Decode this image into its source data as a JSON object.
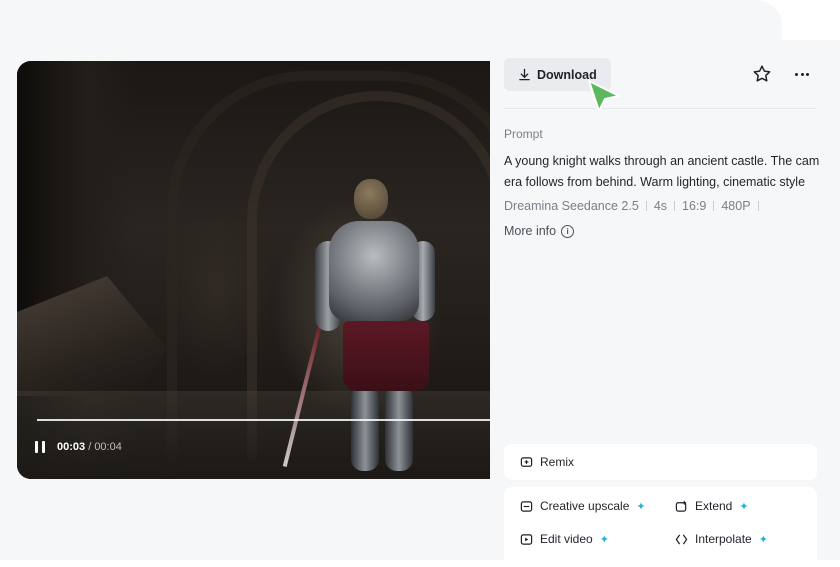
{
  "video": {
    "time_current": "00:03",
    "time_separator": " / ",
    "time_total": "00:04",
    "progress": 0.98
  },
  "toolbar": {
    "download_label": "Download"
  },
  "details": {
    "prompt_label": "Prompt",
    "prompt_text": "A young knight walks through an ancient castle. The camera follows from behind. Warm lighting, cinematic style",
    "meta": [
      "Dreamina Seedance 2.5",
      "4s",
      "16:9",
      "480P"
    ],
    "more_info_label": "More info"
  },
  "actions": {
    "remix": "Remix",
    "creative_upscale": "Creative upscale",
    "extend": "Extend",
    "edit_video": "Edit video",
    "interpolate": "Interpolate"
  },
  "colors": {
    "accent_sparkle": "#1fb6d6",
    "cursor": "#5cb85c",
    "panel_bg": "#f6f7f9"
  }
}
